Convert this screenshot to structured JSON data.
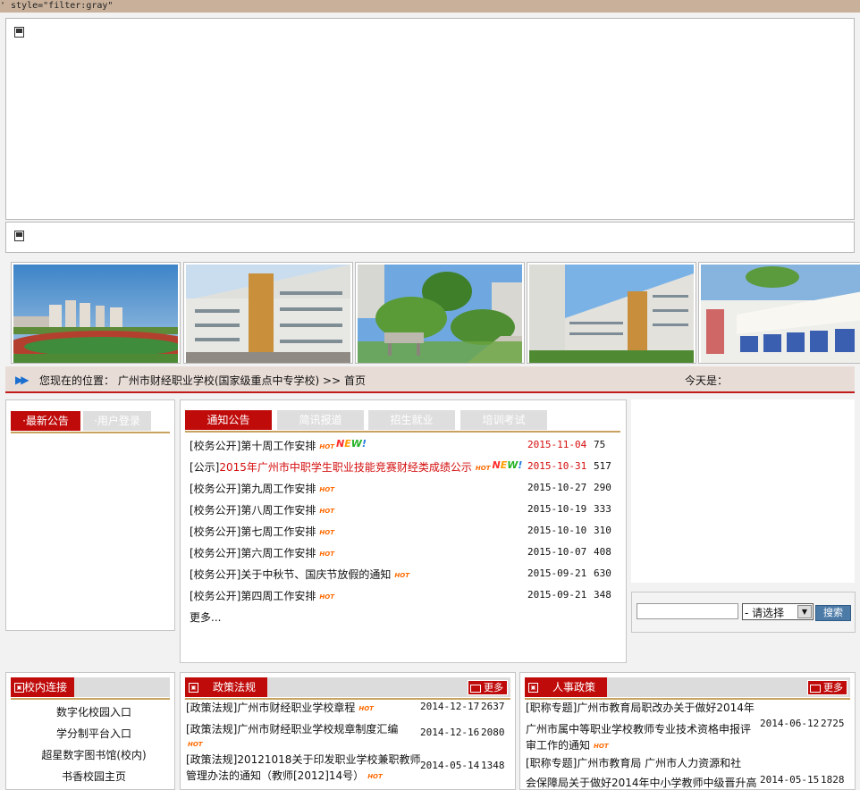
{
  "top_code": "' style=\"filter:gray\"",
  "breadcrumb": {
    "prefix": "您现在的位置：",
    "school": "广州市财经职业学校(国家级重点中专学校)",
    "sep": ">>",
    "home": "首页",
    "today_label": "今天是："
  },
  "left_tabs": {
    "latest": "·最新公告",
    "login": "·用户登录"
  },
  "center_tabs": [
    "通知公告",
    "简讯报道",
    "招生就业",
    "培训考试"
  ],
  "notices": [
    {
      "prefix": "[校务公开]",
      "title": "第十周工作安排",
      "hot": true,
      "new": true,
      "date": "2015-11-04",
      "count": "75",
      "date_red": true,
      "title_red": false
    },
    {
      "prefix": "[公示]",
      "title": "2015年广州市中职学生职业技能竞赛财经类成绩公示",
      "hot": true,
      "new": true,
      "date": "2015-10-31",
      "count": "517",
      "date_red": true,
      "title_red": true
    },
    {
      "prefix": "[校务公开]",
      "title": "第九周工作安排",
      "hot": true,
      "new": false,
      "date": "2015-10-27",
      "count": "290",
      "date_red": false,
      "title_red": false
    },
    {
      "prefix": "[校务公开]",
      "title": "第八周工作安排",
      "hot": true,
      "new": false,
      "date": "2015-10-19",
      "count": "333",
      "date_red": false,
      "title_red": false
    },
    {
      "prefix": "[校务公开]",
      "title": "第七周工作安排",
      "hot": true,
      "new": false,
      "date": "2015-10-10",
      "count": "310",
      "date_red": false,
      "title_red": false
    },
    {
      "prefix": "[校务公开]",
      "title": "第六周工作安排",
      "hot": true,
      "new": false,
      "date": "2015-10-07",
      "count": "408",
      "date_red": false,
      "title_red": false
    },
    {
      "prefix": "[校务公开]",
      "title": "关于中秋节、国庆节放假的通知",
      "hot": true,
      "new": false,
      "date": "2015-09-21",
      "count": "630",
      "date_red": false,
      "title_red": false
    },
    {
      "prefix": "[校务公开]",
      "title": "第四周工作安排",
      "hot": true,
      "new": false,
      "date": "2015-09-21",
      "count": "348",
      "date_red": false,
      "title_red": false
    }
  ],
  "notices_more": "更多...",
  "hot_text": "HOT",
  "new_text": [
    "N",
    "E",
    "W",
    "!"
  ],
  "search": {
    "select_value": "- 请选择",
    "button": "搜索",
    "input_value": ""
  },
  "campus_links": {
    "title": "校内连接",
    "items": [
      "数字化校园入口",
      "学分制平台入口",
      "超星数字图书馆(校内)",
      "书香校园主页"
    ]
  },
  "policy": {
    "title": "政策法规",
    "more": "更多",
    "rows": [
      {
        "line1": "[政策法规]广州市财经职业学校章程",
        "line2": "",
        "date": "2014-12-17",
        "count": "2637"
      },
      {
        "line1": "[政策法规]广州市财经职业学校规章制度汇编",
        "line2": "",
        "date": "2014-12-16",
        "count": "2080"
      },
      {
        "line1": "[政策法规]20121018关于印发职业学校兼职教师",
        "line2": "管理办法的通知（教师[2012]14号）",
        "date": "2014-05-14",
        "count": "1348"
      }
    ]
  },
  "hr": {
    "title": "人事政策",
    "more": "更多",
    "rows": [
      {
        "line1": "[职称专题]广州市教育局职改办关于做好2014年",
        "line2": "广州市属中等职业学校教师专业技术资格申报评",
        "line3": "审工作的通知",
        "date": "2014-06-12",
        "count": "2725"
      },
      {
        "line1": "[职称专题]广州市教育局  广州市人力资源和社",
        "line2": "会保障局关于做好2014年中小学教师中级晋升高",
        "date": "2014-05-15",
        "count": "1828"
      }
    ]
  }
}
